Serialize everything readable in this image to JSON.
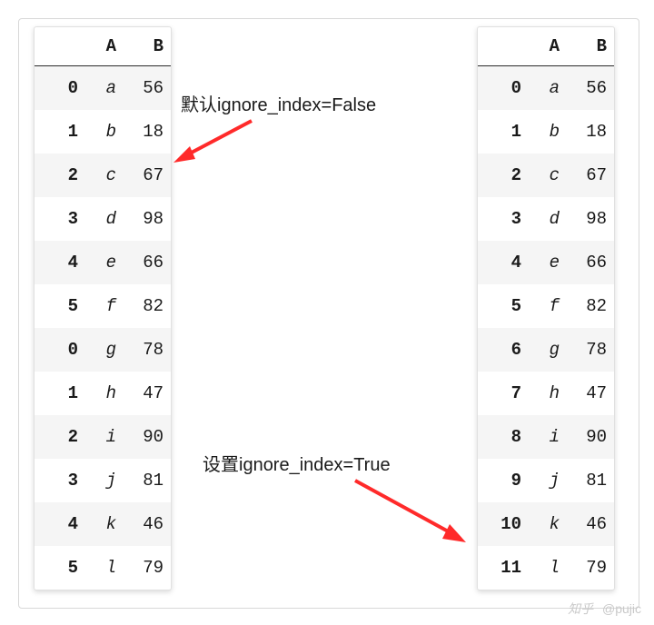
{
  "left_table": {
    "columns": [
      "A",
      "B"
    ],
    "rows": [
      {
        "idx": "0",
        "A": "a",
        "B": "56"
      },
      {
        "idx": "1",
        "A": "b",
        "B": "18"
      },
      {
        "idx": "2",
        "A": "c",
        "B": "67"
      },
      {
        "idx": "3",
        "A": "d",
        "B": "98"
      },
      {
        "idx": "4",
        "A": "e",
        "B": "66"
      },
      {
        "idx": "5",
        "A": "f",
        "B": "82"
      },
      {
        "idx": "0",
        "A": "g",
        "B": "78"
      },
      {
        "idx": "1",
        "A": "h",
        "B": "47"
      },
      {
        "idx": "2",
        "A": "i",
        "B": "90"
      },
      {
        "idx": "3",
        "A": "j",
        "B": "81"
      },
      {
        "idx": "4",
        "A": "k",
        "B": "46"
      },
      {
        "idx": "5",
        "A": "l",
        "B": "79"
      }
    ]
  },
  "right_table": {
    "columns": [
      "A",
      "B"
    ],
    "rows": [
      {
        "idx": "0",
        "A": "a",
        "B": "56"
      },
      {
        "idx": "1",
        "A": "b",
        "B": "18"
      },
      {
        "idx": "2",
        "A": "c",
        "B": "67"
      },
      {
        "idx": "3",
        "A": "d",
        "B": "98"
      },
      {
        "idx": "4",
        "A": "e",
        "B": "66"
      },
      {
        "idx": "5",
        "A": "f",
        "B": "82"
      },
      {
        "idx": "6",
        "A": "g",
        "B": "78"
      },
      {
        "idx": "7",
        "A": "h",
        "B": "47"
      },
      {
        "idx": "8",
        "A": "i",
        "B": "90"
      },
      {
        "idx": "9",
        "A": "j",
        "B": "81"
      },
      {
        "idx": "10",
        "A": "k",
        "B": "46"
      },
      {
        "idx": "11",
        "A": "l",
        "B": "79"
      }
    ]
  },
  "captions": {
    "top": "默认ignore_index=False",
    "bottom": "设置ignore_index=True"
  },
  "watermark": {
    "site": "知乎",
    "user": "@pujic"
  }
}
